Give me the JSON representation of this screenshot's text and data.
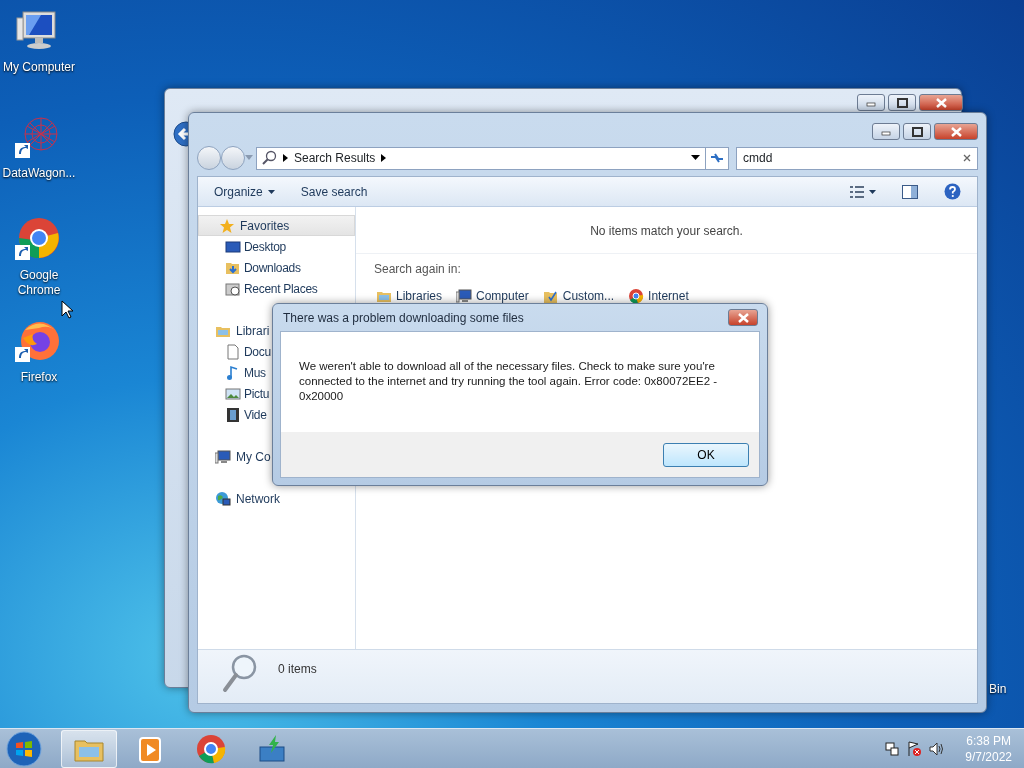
{
  "desktop_icons": [
    {
      "label": "My Computer",
      "kind": "computer",
      "shortcut": false
    },
    {
      "label": "DataWagon...",
      "kind": "mesh",
      "shortcut": true
    },
    {
      "label": "Google Chrome",
      "kind": "chrome",
      "shortcut": true
    },
    {
      "label": "Firefox",
      "kind": "firefox",
      "shortcut": true
    }
  ],
  "desktop_partial_label": "Bin",
  "explorer": {
    "breadcrumb": "Search Results",
    "search_value": "cmdd",
    "commands": [
      {
        "label": "Organize",
        "kind": "menu"
      },
      {
        "label": "Save search",
        "kind": "plain"
      }
    ],
    "nav": [
      {
        "label": "Favorites",
        "kind": "star",
        "selected": true,
        "children": [
          {
            "label": "Desktop",
            "kind": "desktop",
            "selected": false
          },
          {
            "label": "Downloads",
            "kind": "downloads",
            "selected": false
          },
          {
            "label": "Recent Places",
            "kind": "recent",
            "selected": false
          }
        ]
      },
      {
        "label": "Librari",
        "kind": "library",
        "selected": false,
        "children": [
          {
            "label": "Docu",
            "kind": "document",
            "selected": false
          },
          {
            "label": "Mus",
            "kind": "music",
            "selected": false
          },
          {
            "label": "Pictu",
            "kind": "pictures",
            "selected": false
          },
          {
            "label": "Vide",
            "kind": "videos",
            "selected": false
          }
        ]
      },
      {
        "label": "My Co",
        "kind": "computer",
        "selected": false
      },
      {
        "label": "Network",
        "kind": "network",
        "selected": false
      }
    ],
    "no_items": "No items match your search.",
    "search_again_label": "Search again in:",
    "search_again": [
      {
        "label": "Libraries",
        "kind": "library"
      },
      {
        "label": "Computer",
        "kind": "computer"
      },
      {
        "label": "Custom...",
        "kind": "custom"
      },
      {
        "label": "Internet",
        "kind": "chrome"
      }
    ],
    "status": "0 items"
  },
  "dialog": {
    "title": "There was a problem downloading some files",
    "message": "We weren't able to download all of the necessary files. Check to make sure you're connected to the internet and try running the tool again. Error code: 0x80072EE2 - 0x20000",
    "button": "OK"
  },
  "taskbar": {
    "apps": [
      {
        "kind": "explorer",
        "selected": true
      },
      {
        "kind": "media",
        "selected": false
      },
      {
        "kind": "chrome",
        "selected": false
      },
      {
        "kind": "installer",
        "selected": false
      }
    ],
    "time": "6:38 PM",
    "date": "9/7/2022"
  }
}
